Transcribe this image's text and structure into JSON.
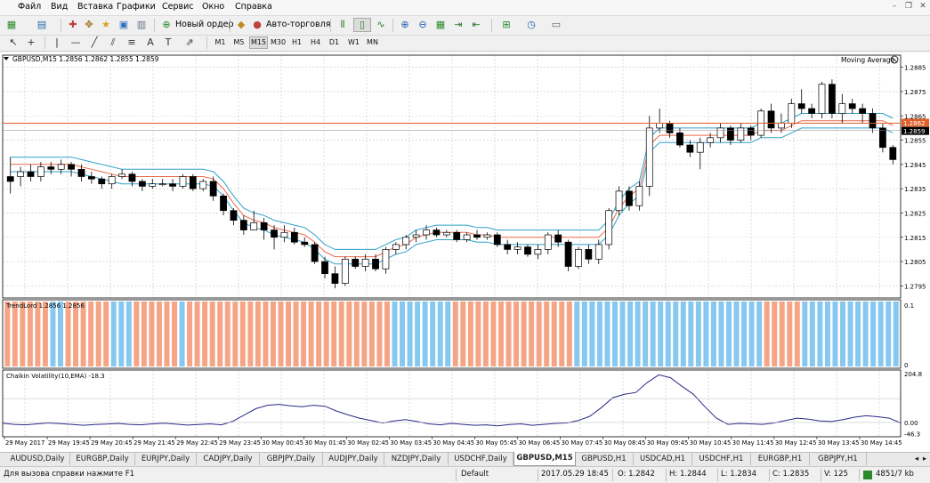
{
  "menu": [
    "Файл",
    "Вид",
    "Вставка",
    "Графики",
    "Сервис",
    "Окно",
    "Справка"
  ],
  "toolbar": {
    "new_order_label": "Новый ордер",
    "auto_trading_label": "Авто-торговля"
  },
  "timeframes": [
    "M1",
    "M5",
    "M15",
    "M30",
    "H1",
    "H4",
    "D1",
    "W1",
    "MN"
  ],
  "active_timeframe": "M15",
  "chart_data": [
    {
      "type": "candlestick",
      "title": "GBPUSD,M15  1.2856 1.2862 1.2855 1.2859",
      "indicator_label": "Moving Average",
      "ylim": [
        1.279,
        1.289
      ],
      "ticks": [
        "1.2885",
        "1.2875",
        "1.2865",
        "1.2855",
        "1.2845",
        "1.2835",
        "1.2825",
        "1.2815",
        "1.2805",
        "1.2795"
      ],
      "tick_values": [
        1.2885,
        1.2875,
        1.2865,
        1.2855,
        1.2845,
        1.2835,
        1.2825,
        1.2815,
        1.2805,
        1.2795
      ],
      "price_line": 1.2862,
      "price_line_label": "1.2862",
      "bid_label": "1.2859",
      "bid_value": 1.2859,
      "candles": [
        [
          1.284,
          1.2838,
          1.2848,
          1.2833
        ],
        [
          1.284,
          1.2842,
          1.2844,
          1.2836
        ],
        [
          1.2842,
          1.284,
          1.2845,
          1.2838
        ],
        [
          1.284,
          1.2844,
          1.2846,
          1.2838
        ],
        [
          1.2844,
          1.2843,
          1.2846,
          1.2841
        ],
        [
          1.2843,
          1.2845,
          1.2847,
          1.2841
        ],
        [
          1.2845,
          1.2843,
          1.2846,
          1.284
        ],
        [
          1.2843,
          1.284,
          1.2845,
          1.2838
        ],
        [
          1.284,
          1.2839,
          1.2842,
          1.2837
        ],
        [
          1.2839,
          1.2837,
          1.284,
          1.2835
        ],
        [
          1.2837,
          1.284,
          1.2841,
          1.2835
        ],
        [
          1.284,
          1.2841,
          1.2843,
          1.2839
        ],
        [
          1.2841,
          1.2838,
          1.2842,
          1.2836
        ],
        [
          1.2838,
          1.2836,
          1.2839,
          1.2834
        ],
        [
          1.2836,
          1.2837,
          1.2839,
          1.2835
        ],
        [
          1.2837,
          1.2837,
          1.2839,
          1.2836
        ],
        [
          1.2837,
          1.2836,
          1.2839,
          1.2834
        ],
        [
          1.2836,
          1.284,
          1.2841,
          1.2835
        ],
        [
          1.284,
          1.2835,
          1.2841,
          1.2834
        ],
        [
          1.2835,
          1.2838,
          1.2839,
          1.2834
        ],
        [
          1.2838,
          1.2832,
          1.284,
          1.283
        ],
        [
          1.2832,
          1.2826,
          1.2833,
          1.2824
        ],
        [
          1.2826,
          1.2822,
          1.2827,
          1.282
        ],
        [
          1.2822,
          1.2818,
          1.2824,
          1.2816
        ],
        [
          1.2818,
          1.2821,
          1.2826,
          1.2818
        ],
        [
          1.2821,
          1.2818,
          1.2823,
          1.2814
        ],
        [
          1.2818,
          1.2815,
          1.282,
          1.281
        ],
        [
          1.2815,
          1.2817,
          1.282,
          1.2813
        ],
        [
          1.2817,
          1.2813,
          1.2819,
          1.2812
        ],
        [
          1.2813,
          1.2812,
          1.2815,
          1.2811
        ],
        [
          1.2812,
          1.2805,
          1.2813,
          1.2804
        ],
        [
          1.2805,
          1.28,
          1.2807,
          1.2798
        ],
        [
          1.28,
          1.2796,
          1.2803,
          1.2794
        ],
        [
          1.2796,
          1.2806,
          1.2807,
          1.2795
        ],
        [
          1.2806,
          1.2803,
          1.2807,
          1.2802
        ],
        [
          1.2803,
          1.2806,
          1.2808,
          1.2801
        ],
        [
          1.2806,
          1.2802,
          1.2808,
          1.2801
        ],
        [
          1.2802,
          1.281,
          1.2811,
          1.28
        ],
        [
          1.281,
          1.2812,
          1.2813,
          1.2808
        ],
        [
          1.2812,
          1.2815,
          1.2816,
          1.281
        ],
        [
          1.2815,
          1.2816,
          1.2818,
          1.2813
        ],
        [
          1.2816,
          1.2818,
          1.282,
          1.2814
        ],
        [
          1.2818,
          1.2816,
          1.2819,
          1.2815
        ],
        [
          1.2816,
          1.2817,
          1.2818,
          1.2815
        ],
        [
          1.2817,
          1.2814,
          1.2818,
          1.2813
        ],
        [
          1.2814,
          1.2816,
          1.2817,
          1.2813
        ],
        [
          1.2816,
          1.2815,
          1.2818,
          1.2814
        ],
        [
          1.2815,
          1.2816,
          1.2817,
          1.2814
        ],
        [
          1.2816,
          1.2812,
          1.2817,
          1.2811
        ],
        [
          1.2812,
          1.281,
          1.2814,
          1.2808
        ],
        [
          1.281,
          1.2811,
          1.2813,
          1.2808
        ],
        [
          1.2811,
          1.2808,
          1.2812,
          1.2807
        ],
        [
          1.2808,
          1.281,
          1.2812,
          1.2806
        ],
        [
          1.281,
          1.2816,
          1.2817,
          1.2808
        ],
        [
          1.2816,
          1.2813,
          1.2818,
          1.2811
        ],
        [
          1.2813,
          1.2803,
          1.2814,
          1.2801
        ],
        [
          1.2803,
          1.281,
          1.2811,
          1.2802
        ],
        [
          1.281,
          1.2806,
          1.2812,
          1.2804
        ],
        [
          1.2806,
          1.2812,
          1.2814,
          1.2804
        ],
        [
          1.2812,
          1.2826,
          1.2827,
          1.281
        ],
        [
          1.2826,
          1.2834,
          1.2836,
          1.2824
        ],
        [
          1.2834,
          1.2828,
          1.2836,
          1.2826
        ],
        [
          1.2828,
          1.2836,
          1.2838,
          1.2826
        ],
        [
          1.2836,
          1.286,
          1.2865,
          1.2832
        ],
        [
          1.286,
          1.2862,
          1.2868,
          1.2858
        ],
        [
          1.2862,
          1.2858,
          1.2863,
          1.2856
        ],
        [
          1.2858,
          1.2853,
          1.286,
          1.2852
        ],
        [
          1.2853,
          1.285,
          1.2855,
          1.2848
        ],
        [
          1.285,
          1.2854,
          1.2856,
          1.2843
        ],
        [
          1.2854,
          1.2856,
          1.2858,
          1.2852
        ],
        [
          1.2856,
          1.286,
          1.2862,
          1.2854
        ],
        [
          1.286,
          1.2855,
          1.2861,
          1.2853
        ],
        [
          1.2855,
          1.286,
          1.2862,
          1.2854
        ],
        [
          1.286,
          1.2857,
          1.2861,
          1.2855
        ],
        [
          1.2857,
          1.2867,
          1.2868,
          1.2856
        ],
        [
          1.2867,
          1.286,
          1.287,
          1.2858
        ],
        [
          1.286,
          1.2862,
          1.2866,
          1.2858
        ],
        [
          1.2862,
          1.287,
          1.2872,
          1.286
        ],
        [
          1.287,
          1.2868,
          1.2876,
          1.2866
        ],
        [
          1.2868,
          1.2866,
          1.287,
          1.2864
        ],
        [
          1.2866,
          1.2878,
          1.2879,
          1.2864
        ],
        [
          1.2878,
          1.2866,
          1.288,
          1.2864
        ],
        [
          1.2866,
          1.287,
          1.2874,
          1.2862
        ],
        [
          1.287,
          1.2868,
          1.2872,
          1.2866
        ],
        [
          1.2868,
          1.2866,
          1.287,
          1.2862
        ],
        [
          1.2866,
          1.286,
          1.2868,
          1.2858
        ],
        [
          1.286,
          1.2852,
          1.2862,
          1.285
        ],
        [
          1.2852,
          1.2847,
          1.2853,
          1.2845
        ]
      ],
      "ma_upper": [
        1.2848,
        1.2848,
        1.2848,
        1.2848,
        1.2848,
        1.2848,
        1.2848,
        1.2847,
        1.2846,
        1.2845,
        1.2844,
        1.2843,
        1.2843,
        1.2843,
        1.2843,
        1.2843,
        1.2843,
        1.2843,
        1.2843,
        1.2843,
        1.2842,
        1.2838,
        1.2832,
        1.2827,
        1.2825,
        1.2824,
        1.2822,
        1.2821,
        1.282,
        1.2819,
        1.2816,
        1.2812,
        1.281,
        1.281,
        1.281,
        1.281,
        1.281,
        1.2812,
        1.2814,
        1.2815,
        1.2818,
        1.2819,
        1.282,
        1.282,
        1.282,
        1.282,
        1.2819,
        1.2819,
        1.2818,
        1.2818,
        1.2818,
        1.2818,
        1.2818,
        1.2818,
        1.2818,
        1.2818,
        1.2818,
        1.2818,
        1.2818,
        1.2822,
        1.283,
        1.2835,
        1.2838,
        1.2856,
        1.286,
        1.286,
        1.286,
        1.286,
        1.286,
        1.286,
        1.286,
        1.286,
        1.286,
        1.286,
        1.2862,
        1.2862,
        1.2862,
        1.2864,
        1.2866,
        1.2866,
        1.2866,
        1.2866,
        1.2866,
        1.2866,
        1.2866,
        1.2866,
        1.2866,
        1.2864
      ],
      "ma_mid": [
        1.2845,
        1.2845,
        1.2845,
        1.2845,
        1.2845,
        1.2845,
        1.2845,
        1.2844,
        1.2843,
        1.2842,
        1.2841,
        1.284,
        1.284,
        1.284,
        1.284,
        1.284,
        1.284,
        1.284,
        1.284,
        1.284,
        1.2839,
        1.2835,
        1.2829,
        1.2824,
        1.2822,
        1.2821,
        1.2819,
        1.2818,
        1.2817,
        1.2816,
        1.2813,
        1.2809,
        1.2807,
        1.2807,
        1.2807,
        1.2807,
        1.2807,
        1.2809,
        1.2811,
        1.2812,
        1.2815,
        1.2816,
        1.2817,
        1.2817,
        1.2817,
        1.2817,
        1.2816,
        1.2816,
        1.2815,
        1.2815,
        1.2815,
        1.2815,
        1.2815,
        1.2815,
        1.2815,
        1.2815,
        1.2815,
        1.2815,
        1.2815,
        1.2819,
        1.2827,
        1.2832,
        1.2835,
        1.2853,
        1.2857,
        1.2857,
        1.2857,
        1.2857,
        1.2857,
        1.2857,
        1.2857,
        1.2857,
        1.2857,
        1.2857,
        1.2859,
        1.2859,
        1.2859,
        1.2861,
        1.2863,
        1.2863,
        1.2863,
        1.2863,
        1.2863,
        1.2863,
        1.2863,
        1.2863,
        1.2863,
        1.2861
      ],
      "ma_lower": [
        1.2842,
        1.2842,
        1.2842,
        1.2842,
        1.2842,
        1.2842,
        1.2842,
        1.2841,
        1.284,
        1.2839,
        1.2838,
        1.2837,
        1.2837,
        1.2837,
        1.2837,
        1.2837,
        1.2837,
        1.2837,
        1.2837,
        1.2837,
        1.2836,
        1.2832,
        1.2826,
        1.2821,
        1.2819,
        1.2818,
        1.2816,
        1.2815,
        1.2814,
        1.2813,
        1.281,
        1.2806,
        1.2804,
        1.2804,
        1.2804,
        1.2804,
        1.2804,
        1.2806,
        1.2808,
        1.2809,
        1.2812,
        1.2813,
        1.2814,
        1.2814,
        1.2814,
        1.2814,
        1.2813,
        1.2813,
        1.2812,
        1.2812,
        1.2812,
        1.2812,
        1.2812,
        1.2812,
        1.2812,
        1.2812,
        1.2812,
        1.2812,
        1.2812,
        1.2816,
        1.2824,
        1.2829,
        1.2832,
        1.285,
        1.2854,
        1.2854,
        1.2854,
        1.2854,
        1.2854,
        1.2854,
        1.2854,
        1.2854,
        1.2854,
        1.2854,
        1.2856,
        1.2856,
        1.2856,
        1.2858,
        1.286,
        1.286,
        1.286,
        1.286,
        1.286,
        1.286,
        1.286,
        1.286,
        1.286,
        1.2858
      ],
      "x_ticks": [
        "29 May 2017",
        "29 May 19:45",
        "29 May 20:45",
        "29 May 21:45",
        "29 May 22:45",
        "29 May 23:45",
        "30 May 00:45",
        "30 May 01:45",
        "30 May 02:45",
        "30 May 03:45",
        "30 May 04:45",
        "30 May 05:45",
        "30 May 06:45",
        "30 May 07:45",
        "30 May 08:45",
        "30 May 09:45",
        "30 May 10:45",
        "30 May 11:45",
        "30 May 12:45",
        "30 May 13:45",
        "30 May 14:45"
      ]
    },
    {
      "type": "bar",
      "title": "TrendLord 1.2856 1.2856",
      "ticks": [
        "0.1",
        "0"
      ],
      "colors": {
        "up": "#87c8f0",
        "down": "#f5a585"
      },
      "series": "ddddddbbddddddbbbddddddbdddddddddddddddddddddddddddbbbbbbbbddddddddddddddddbbbbbbbbbbbbbbbbbbbbbbbbbdddddbbbbbbbbbbbbb"
    },
    {
      "type": "line",
      "title": "Chaikin Volatility(10,EMA) -18.3",
      "ylim": [
        -60,
        220
      ],
      "ticks": [
        "204.8",
        "0.00",
        "-46.3"
      ],
      "tick_values": [
        204.8,
        0,
        -46.3
      ],
      "level_value": 100,
      "values": [
        -3,
        -8,
        -10,
        -6,
        -2,
        -5,
        -8,
        -12,
        -9,
        -7,
        -4,
        -8,
        -10,
        -6,
        -3,
        -7,
        -11,
        -9,
        -6,
        -10,
        5,
        32,
        58,
        72,
        76,
        70,
        66,
        72,
        68,
        48,
        32,
        18,
        8,
        -2,
        6,
        12,
        4,
        -6,
        -10,
        -4,
        -8,
        -12,
        -10,
        -14,
        -9,
        -6,
        -12,
        -8,
        -4,
        -2,
        8,
        26,
        62,
        104,
        118,
        126,
        168,
        200,
        188,
        152,
        118,
        66,
        18,
        -8,
        -4,
        -6,
        -8,
        -2,
        8,
        18,
        14,
        6,
        4,
        12,
        22,
        28,
        24,
        18,
        -2
      ]
    }
  ],
  "symbol_tabs": [
    "AUDUSD,Daily",
    "EURGBP,Daily",
    "EURJPY,Daily",
    "CADJPY,Daily",
    "GBPJPY,Daily",
    "AUDJPY,Daily",
    "NZDJPY,Daily",
    "USDCHF,Daily",
    "GBPUSD,M15",
    "GBPUSD,H1",
    "USDCAD,H1",
    "USDCHF,H1",
    "EURGBP,H1",
    "GBPJPY,H1"
  ],
  "active_tab": "GBPUSD,M15",
  "status": {
    "help": "Для вызова справки нажмите F1",
    "profile": "Default",
    "datetime": "2017.05.29 18:45",
    "open": "O: 1.2842",
    "high": "H: 1.2844",
    "low": "L: 1.2834",
    "close": "C: 1.2835",
    "volume": "V: 125",
    "traffic": "4851/7 kb"
  }
}
